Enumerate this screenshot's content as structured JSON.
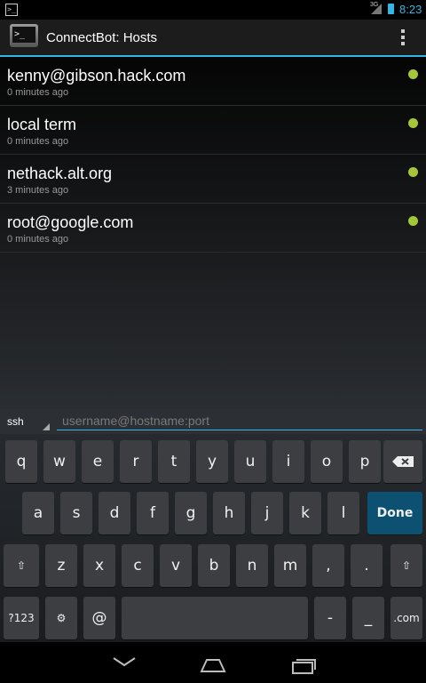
{
  "status_bar": {
    "time": "8:23",
    "network_label": "3G",
    "terminal_glyph": ">_"
  },
  "action_bar": {
    "title": "ConnectBot: Hosts",
    "icon_glyph": ">_"
  },
  "hosts": [
    {
      "name": "kenny@gibson.hack.com",
      "last_connect": "0 minutes ago"
    },
    {
      "name": "local term",
      "last_connect": "0 minutes ago"
    },
    {
      "name": "nethack.alt.org",
      "last_connect": "3 minutes ago"
    },
    {
      "name": "root@google.com",
      "last_connect": "0 minutes ago"
    }
  ],
  "quick_connect": {
    "protocol": "ssh",
    "placeholder": "username@hostname:port",
    "value": ""
  },
  "keyboard": {
    "row1": [
      "q",
      "w",
      "e",
      "r",
      "t",
      "y",
      "u",
      "i",
      "o",
      "p"
    ],
    "row2": [
      "a",
      "s",
      "d",
      "f",
      "g",
      "h",
      "j",
      "k",
      "l"
    ],
    "row3": [
      "z",
      "x",
      "c",
      "v",
      "b",
      "n",
      "m",
      ",",
      "."
    ],
    "done_label": "Done",
    "symbols_label": "?123",
    "at_label": "@",
    "dash_label": "-",
    "underscore_label": "_",
    "dotcom_label": ".com",
    "shift_glyph": "⇧",
    "settings_glyph": "⚙"
  },
  "colors": {
    "accent": "#33b5e5",
    "online_dot": "#a4c639",
    "done_key": "#0d5172"
  }
}
